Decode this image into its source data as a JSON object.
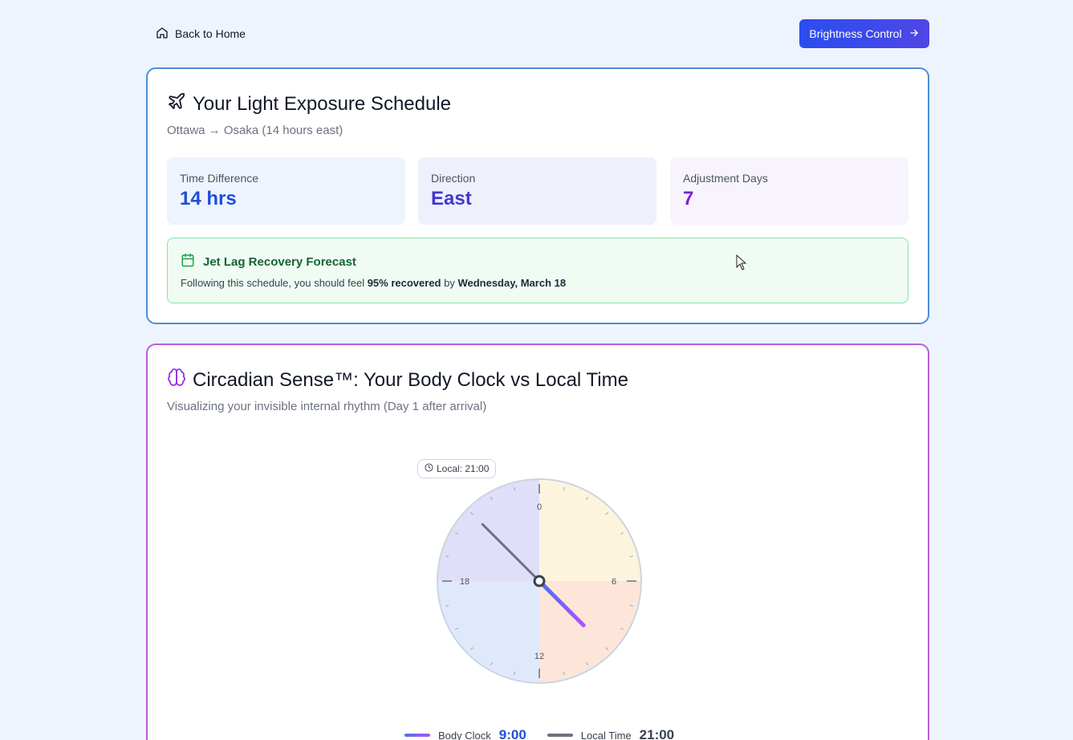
{
  "nav": {
    "back_label": "Back to Home",
    "brightness_label": "Brightness Control"
  },
  "schedule": {
    "title": "Your Light Exposure Schedule",
    "subtitle": "Ottawa → Osaka (14 hours east)",
    "stats": [
      {
        "label": "Time Difference",
        "value": "14 hrs"
      },
      {
        "label": "Direction",
        "value": "East"
      },
      {
        "label": "Adjustment Days",
        "value": "7"
      }
    ],
    "forecast": {
      "title": "Jet Lag Recovery Forecast",
      "text_prefix": "Following this schedule, you should feel ",
      "recovered": "95% recovered",
      "text_mid": " by ",
      "date": "Wednesday, March 18"
    }
  },
  "circadian": {
    "title": "Circadian Sense™: Your Body Clock vs Local Time",
    "subtitle": "Visualizing your invisible internal rhythm (Day 1 after arrival)",
    "local_pill": "Local: 21:00",
    "dial_labels": [
      "0",
      "6",
      "12",
      "18"
    ],
    "body_clock_hour": 9,
    "local_time_hour": 21,
    "legend": {
      "body_label": "Body Clock",
      "body_value": "9:00",
      "local_label": "Local Time",
      "local_value": "21:00"
    },
    "colors": {
      "quadrant_night": "#e0def9",
      "quadrant_morning": "#fdf4de",
      "quadrant_afternoon": "#fde5da",
      "quadrant_evening": "#e0e9fb",
      "body_hand": "#6d5ff0",
      "local_hand": "#6b7280"
    }
  }
}
